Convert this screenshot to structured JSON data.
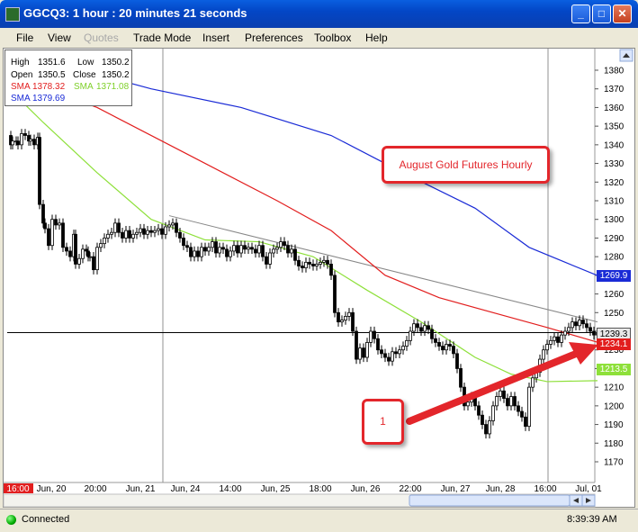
{
  "window": {
    "title": "GGCQ3: 1 hour : 20 minutes 21 seconds"
  },
  "menu": [
    "File",
    "View",
    "Quotes",
    "Trade Mode",
    "Insert",
    "Preferences",
    "Toolbox",
    "Help"
  ],
  "menu_disabled": [
    "Quotes"
  ],
  "quote_box": {
    "high_label": "High",
    "high": "1351.6",
    "low_label": "Low",
    "low": "1350.2",
    "open_label": "Open",
    "open": "1350.5",
    "close_label": "Close",
    "close": "1350.2",
    "sma1_label": "SMA",
    "sma1": "1378.32",
    "sma2_label": "SMA",
    "sma2": "1371.08",
    "sma3_label": "SMA",
    "sma3": "1379.69"
  },
  "annotation_title": "August Gold Futures Hourly",
  "annotation_number": "1",
  "price_tags": {
    "last": "1239.3",
    "sma_red": "1234.1",
    "sma_green": "1213.5",
    "sma_blue": "1269.9"
  },
  "colors": {
    "sma_red": "#e21e1e",
    "sma_green": "#8ee03a",
    "sma_blue": "#1a2bd6",
    "annotation": "#e3262b",
    "candle": "#000000",
    "trendline": "#888888"
  },
  "status": {
    "connection": "Connected",
    "time": "8:39:39 AM"
  },
  "chart_data": {
    "type": "candlestick",
    "y_ticks": [
      1380,
      1370,
      1360,
      1350,
      1340,
      1330,
      1320,
      1310,
      1300,
      1290,
      1280,
      1270,
      1260,
      1250,
      1240,
      1230,
      1220,
      1210,
      1200,
      1190,
      1180,
      1170
    ],
    "ylim": [
      1165,
      1388
    ],
    "x_labels": [
      "16:00",
      "Jun, 20",
      "20:00",
      "Jun, 21",
      "Jun, 24",
      "14:00",
      "Jun, 25",
      "18:00",
      "Jun, 26",
      "22:00",
      "Jun, 27",
      "Jun, 28",
      "16:00",
      "Jul, 01"
    ],
    "last_price": 1239.3,
    "close_path": [
      [
        0,
        1345
      ],
      [
        4,
        1340
      ],
      [
        6,
        1342
      ],
      [
        10,
        1342
      ],
      [
        12,
        1340
      ],
      [
        16,
        1346
      ],
      [
        20,
        1345
      ],
      [
        24,
        1342
      ],
      [
        26,
        1343
      ],
      [
        30,
        1340
      ],
      [
        34,
        1344
      ],
      [
        36,
        1308
      ],
      [
        40,
        1298
      ],
      [
        42,
        1295
      ],
      [
        46,
        1286
      ],
      [
        50,
        1300
      ],
      [
        54,
        1297
      ],
      [
        58,
        1298
      ],
      [
        62,
        1285
      ],
      [
        66,
        1283
      ],
      [
        70,
        1280
      ],
      [
        74,
        1292
      ],
      [
        76,
        1276
      ],
      [
        80,
        1279
      ],
      [
        84,
        1284
      ],
      [
        88,
        1283
      ],
      [
        90,
        1280
      ],
      [
        92,
        1280
      ],
      [
        96,
        1273
      ],
      [
        100,
        1285
      ],
      [
        104,
        1287
      ],
      [
        108,
        1290
      ],
      [
        112,
        1292
      ],
      [
        116,
        1293
      ],
      [
        120,
        1298
      ],
      [
        124,
        1293
      ],
      [
        128,
        1290
      ],
      [
        132,
        1294
      ],
      [
        136,
        1290
      ],
      [
        140,
        1292
      ],
      [
        144,
        1293
      ],
      [
        148,
        1295
      ],
      [
        152,
        1292
      ],
      [
        156,
        1294
      ],
      [
        160,
        1293
      ],
      [
        164,
        1294
      ],
      [
        168,
        1295
      ],
      [
        172,
        1292
      ],
      [
        176,
        1296
      ],
      [
        180,
        1297
      ],
      [
        184,
        1298
      ],
      [
        188,
        1293
      ],
      [
        192,
        1290
      ],
      [
        196,
        1286
      ],
      [
        200,
        1285
      ],
      [
        204,
        1280
      ],
      [
        208,
        1283
      ],
      [
        212,
        1280
      ],
      [
        216,
        1285
      ],
      [
        220,
        1283
      ],
      [
        224,
        1285
      ],
      [
        228,
        1288
      ],
      [
        232,
        1282
      ],
      [
        236,
        1285
      ],
      [
        240,
        1284
      ],
      [
        244,
        1280
      ],
      [
        248,
        1283
      ],
      [
        252,
        1286
      ],
      [
        256,
        1282
      ],
      [
        260,
        1286
      ],
      [
        264,
        1284
      ],
      [
        268,
        1285
      ],
      [
        272,
        1284
      ],
      [
        276,
        1282
      ],
      [
        280,
        1286
      ],
      [
        284,
        1280
      ],
      [
        288,
        1276
      ],
      [
        292,
        1282
      ],
      [
        296,
        1284
      ],
      [
        300,
        1285
      ],
      [
        304,
        1288
      ],
      [
        308,
        1286
      ],
      [
        312,
        1282
      ],
      [
        316,
        1284
      ],
      [
        320,
        1278
      ],
      [
        324,
        1275
      ],
      [
        328,
        1274
      ],
      [
        332,
        1277
      ],
      [
        336,
        1276
      ],
      [
        340,
        1275
      ],
      [
        344,
        1276
      ],
      [
        348,
        1277
      ],
      [
        352,
        1278
      ],
      [
        356,
        1276
      ],
      [
        360,
        1270
      ],
      [
        364,
        1250
      ],
      [
        368,
        1245
      ],
      [
        372,
        1246
      ],
      [
        376,
        1248
      ],
      [
        380,
        1250
      ],
      [
        384,
        1240
      ],
      [
        388,
        1225
      ],
      [
        392,
        1231
      ],
      [
        396,
        1226
      ],
      [
        400,
        1234
      ],
      [
        404,
        1240
      ],
      [
        408,
        1236
      ],
      [
        412,
        1230
      ],
      [
        416,
        1228
      ],
      [
        420,
        1226
      ],
      [
        424,
        1224
      ],
      [
        428,
        1229
      ],
      [
        432,
        1228
      ],
      [
        436,
        1230
      ],
      [
        440,
        1232
      ],
      [
        444,
        1235
      ],
      [
        448,
        1240
      ],
      [
        452,
        1244
      ],
      [
        456,
        1242
      ],
      [
        460,
        1240
      ],
      [
        464,
        1243
      ],
      [
        468,
        1241
      ],
      [
        472,
        1236
      ],
      [
        476,
        1234
      ],
      [
        480,
        1232
      ],
      [
        484,
        1230
      ],
      [
        488,
        1233
      ],
      [
        492,
        1232
      ],
      [
        496,
        1228
      ],
      [
        500,
        1220
      ],
      [
        504,
        1210
      ],
      [
        508,
        1200
      ],
      [
        512,
        1202
      ],
      [
        516,
        1205
      ],
      [
        520,
        1200
      ],
      [
        524,
        1195
      ],
      [
        528,
        1190
      ],
      [
        532,
        1185
      ],
      [
        536,
        1192
      ],
      [
        540,
        1200
      ],
      [
        544,
        1205
      ],
      [
        548,
        1208
      ],
      [
        552,
        1204
      ],
      [
        556,
        1200
      ],
      [
        560,
        1205
      ],
      [
        564,
        1200
      ],
      [
        568,
        1197
      ],
      [
        572,
        1194
      ],
      [
        576,
        1189
      ],
      [
        580,
        1210
      ],
      [
        584,
        1215
      ],
      [
        588,
        1218
      ],
      [
        592,
        1225
      ],
      [
        596,
        1230
      ],
      [
        600,
        1233
      ],
      [
        604,
        1235
      ],
      [
        608,
        1237
      ],
      [
        612,
        1234
      ],
      [
        616,
        1238
      ],
      [
        620,
        1240
      ],
      [
        624,
        1242
      ],
      [
        628,
        1245
      ],
      [
        632,
        1243
      ],
      [
        636,
        1246
      ],
      [
        640,
        1244
      ],
      [
        644,
        1242
      ],
      [
        648,
        1240
      ],
      [
        652,
        1238
      ],
      [
        656,
        1239.3
      ]
    ],
    "sma_red": [
      [
        0,
        1378
      ],
      [
        100,
        1360
      ],
      [
        200,
        1335
      ],
      [
        300,
        1310
      ],
      [
        360,
        1294
      ],
      [
        420,
        1270
      ],
      [
        480,
        1258
      ],
      [
        540,
        1250
      ],
      [
        600,
        1242
      ],
      [
        656,
        1234.1
      ]
    ],
    "sma_green": [
      [
        0,
        1371
      ],
      [
        40,
        1352
      ],
      [
        100,
        1325
      ],
      [
        160,
        1300
      ],
      [
        220,
        1289
      ],
      [
        280,
        1288
      ],
      [
        340,
        1280
      ],
      [
        400,
        1262
      ],
      [
        460,
        1245
      ],
      [
        520,
        1226
      ],
      [
        560,
        1217
      ],
      [
        600,
        1213
      ],
      [
        656,
        1213.5
      ]
    ],
    "sma_blue": [
      [
        60,
        1383
      ],
      [
        160,
        1370
      ],
      [
        260,
        1360
      ],
      [
        360,
        1345
      ],
      [
        440,
        1325
      ],
      [
        520,
        1306
      ],
      [
        580,
        1285
      ],
      [
        620,
        1277
      ],
      [
        656,
        1269.9
      ]
    ],
    "trendline": [
      [
        180,
        1302
      ],
      [
        656,
        1245
      ]
    ]
  }
}
